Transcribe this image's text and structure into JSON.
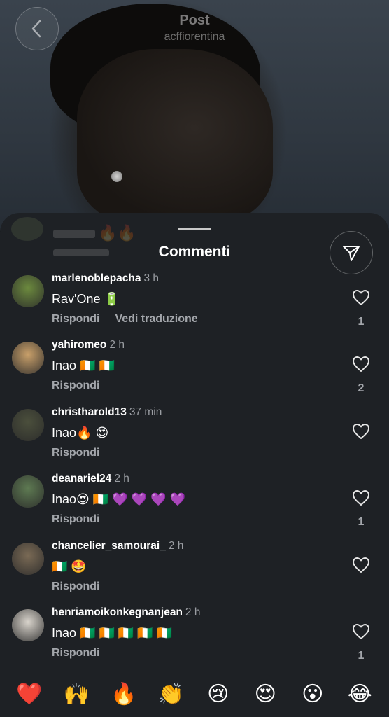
{
  "header": {
    "title": "Post",
    "subtitle": "acffiorentina"
  },
  "sheet": {
    "title": "Commenti"
  },
  "comments": [
    {
      "username": "marlenoblepacha",
      "time": "3 h",
      "text": "Rav'One 🔋",
      "reply_label": "Rispondi",
      "translate_label": "Vedi traduzione",
      "likes": "1",
      "avatar_color": "#6c8a3e"
    },
    {
      "username": "yahiromeo",
      "time": "2 h",
      "text": "Inao 🇨🇮 🇨🇮",
      "reply_label": "Rispondi",
      "likes": "2",
      "avatar_color": "#c9a06a"
    },
    {
      "username": "christharold13",
      "time": "37 min",
      "text": "Inao🔥 😍",
      "reply_label": "Rispondi",
      "likes": "",
      "avatar_color": "#4b4f3c"
    },
    {
      "username": "deanariel24",
      "time": "2 h",
      "text": "Inao😍 🇨🇮 💜 💜 💜 💜",
      "reply_label": "Rispondi",
      "likes": "1",
      "avatar_color": "#5e7a52"
    },
    {
      "username": "chancelier_samourai_",
      "time": "2 h",
      "text": "🇨🇮 🤩",
      "reply_label": "Rispondi",
      "likes": "",
      "avatar_color": "#7a6a55"
    },
    {
      "username": "henriamoikonkegnanjean",
      "time": "2 h",
      "text": "Inao 🇨🇮 🇨🇮 🇨🇮 🇨🇮 🇨🇮",
      "reply_label": "Rispondi",
      "likes": "1",
      "avatar_color": "#d9d4cc"
    }
  ],
  "emoji_bar": [
    "❤️",
    "🙌",
    "🔥",
    "👏",
    "😢",
    "😍",
    "😮",
    "😂"
  ],
  "icons": {
    "back": "chevron-left-icon",
    "filter": "send-icon",
    "like": "heart-outline-icon"
  }
}
